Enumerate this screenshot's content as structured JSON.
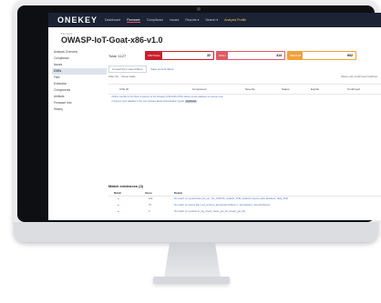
{
  "app": {
    "logo": "ONEKEY"
  },
  "nav": [
    "Dashboard",
    "Firmware",
    "Compliance",
    "Issues",
    "Reports ▾",
    "Search ▾",
    "Analysis Profile"
  ],
  "breadcrumb": "Firmware",
  "page_title": "OWASP-IoT-Goat-x86-v1.0",
  "sidebar": [
    "Analysis Overview",
    "Compliance",
    "Issues",
    "CVEs",
    "Files",
    "Extraction",
    "Components",
    "Artifacts",
    "Firmware Info",
    "History"
  ],
  "sidebar_active": "CVEs",
  "sidebar_expandable": [
    "Artifacts",
    "History"
  ],
  "summary": {
    "total": "Total: 1127",
    "severities": [
      {
        "label": "CRITICAL",
        "count": "22",
        "color": "#c8202f"
      },
      {
        "label": "HIGH",
        "count": "414",
        "color": "#e05a64"
      },
      {
        "label": "MEDIUM",
        "count": "602",
        "color": "#f0a13b"
      }
    ]
  },
  "filters": {
    "placeholder": "Unread from saved filters",
    "save_label": "Save current filters"
  },
  "tools": {
    "filter": "Filter (0)",
    "reset": "Reset table",
    "show_only": "Show only confirmed matches"
  },
  "columns": [
    "CVE ID",
    "Component",
    "Severity",
    "Status",
    "Exploit",
    "Confirmed"
  ],
  "rows": [
    {
      "text": "• Buffer overflow in the httpd component of the firmware (CVE-2023-XXXX) allows remote attackers to execute code",
      "tag": ""
    },
    {
      "text": "• Improper input validation in the web interface allows authentication bypass",
      "tag": "Confirmed"
    }
  ],
  "match": {
    "title": "Match evidences (3)",
    "headers": [
      "Match",
      "Score",
      "Details"
    ],
    "rows": [
      {
        "match": "●",
        "score": "100",
        "details": "No match on symbol lists (md_utc_TLL_PRINTK_CHECK_FOR_CHECK) Source path: Windows, NtrQ_SVR"
      },
      {
        "match": "●",
        "score": "75",
        "details": "No match on source files (md_protocol_kernel) [kernel/linux.c, kernel/task.c, kernel/sched.c]"
      },
      {
        "match": "●",
        "score": "0",
        "details": "No match on symbols (d_log_check_status_get_bit_stream_get_bit)"
      }
    ]
  },
  "colors": {
    "topbar": "#1b2335",
    "accent": "#e84b5a",
    "link": "#5574b8"
  }
}
